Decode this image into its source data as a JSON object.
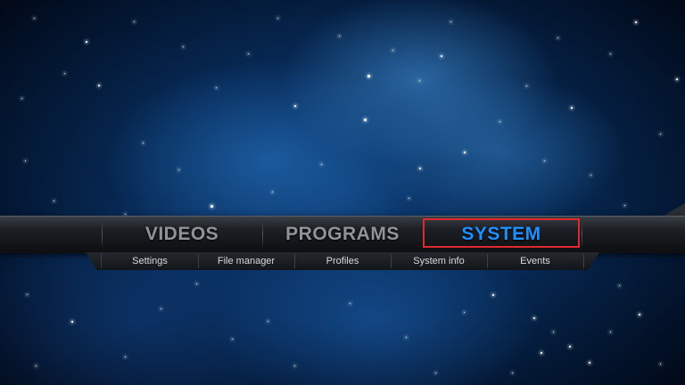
{
  "main_menu": {
    "items": [
      {
        "label": "VIDEOS",
        "selected": false
      },
      {
        "label": "PROGRAMS",
        "selected": false
      },
      {
        "label": "SYSTEM",
        "selected": true
      }
    ]
  },
  "submenu": {
    "items": [
      {
        "label": "Settings"
      },
      {
        "label": "File manager"
      },
      {
        "label": "Profiles"
      },
      {
        "label": "System info"
      },
      {
        "label": "Events"
      }
    ]
  },
  "colors": {
    "selected_item": "#1e90ff",
    "unselected_item": "#8f949a",
    "highlight_border": "#e0282e",
    "submenu_text": "#d8dadc"
  }
}
